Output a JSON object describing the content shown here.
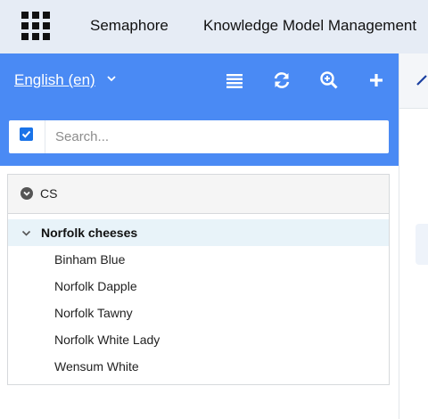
{
  "topbar": {
    "apps_icon": "apps-grid-icon",
    "app_name": "Semaphore",
    "page_name": "Knowledge Model Management"
  },
  "panel": {
    "language": "English (en)",
    "language_caret_icon": "chevron-down-icon",
    "toolbar_icons": [
      "list-icon",
      "refresh-icon",
      "zoom-in-icon",
      "plus-icon"
    ]
  },
  "search": {
    "checkbox_checked": true,
    "placeholder": "Search..."
  },
  "tree": {
    "scheme": {
      "label": "CS",
      "toggle_icon": "chevron-circle-down-icon"
    },
    "concept": {
      "label": "Norfolk cheeses",
      "expanded": true
    },
    "children": [
      "Binham Blue",
      "Norfolk Dapple",
      "Norfolk Tawny",
      "Norfolk White Lady",
      "Wensum White"
    ]
  },
  "colors": {
    "header_blue": "#4a8af4",
    "topbar_bg": "#e6ecf5",
    "selected_row": "#e8f3f9"
  }
}
